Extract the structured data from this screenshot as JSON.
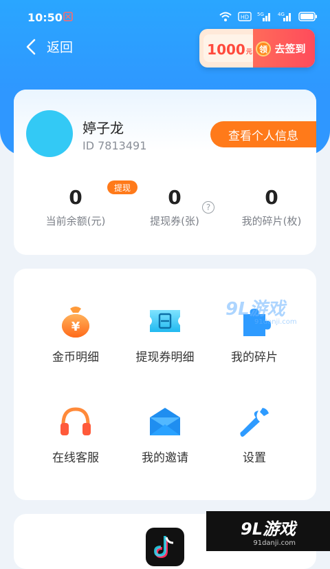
{
  "status_bar": {
    "time": "10:50"
  },
  "nav": {
    "back_label": "返回"
  },
  "signin": {
    "amount": "1000",
    "unit": "元",
    "badge": "领",
    "label": "去签到"
  },
  "profile": {
    "name": "婷子龙",
    "id_text": "ID 7813491",
    "view_button": "查看个人信息",
    "withdraw_tag": "提现",
    "help": "?"
  },
  "stats": [
    {
      "value": "0",
      "label": "当前余额(元)"
    },
    {
      "value": "0",
      "label": "提现券(张)"
    },
    {
      "value": "0",
      "label": "我的碎片(枚)"
    }
  ],
  "menu": [
    {
      "label": "金币明细",
      "icon": "money-bag-icon"
    },
    {
      "label": "提现券明细",
      "icon": "ticket-icon"
    },
    {
      "label": "我的碎片",
      "icon": "puzzle-icon"
    },
    {
      "label": "在线客服",
      "icon": "headphones-icon"
    },
    {
      "label": "我的邀请",
      "icon": "envelope-icon"
    },
    {
      "label": "设置",
      "icon": "wrench-icon"
    }
  ],
  "watermark": {
    "main": "9L游戏",
    "sub": "91danji.com"
  },
  "colors": {
    "primary_blue": "#2f97ff",
    "accent_orange": "#ff7a1a"
  }
}
